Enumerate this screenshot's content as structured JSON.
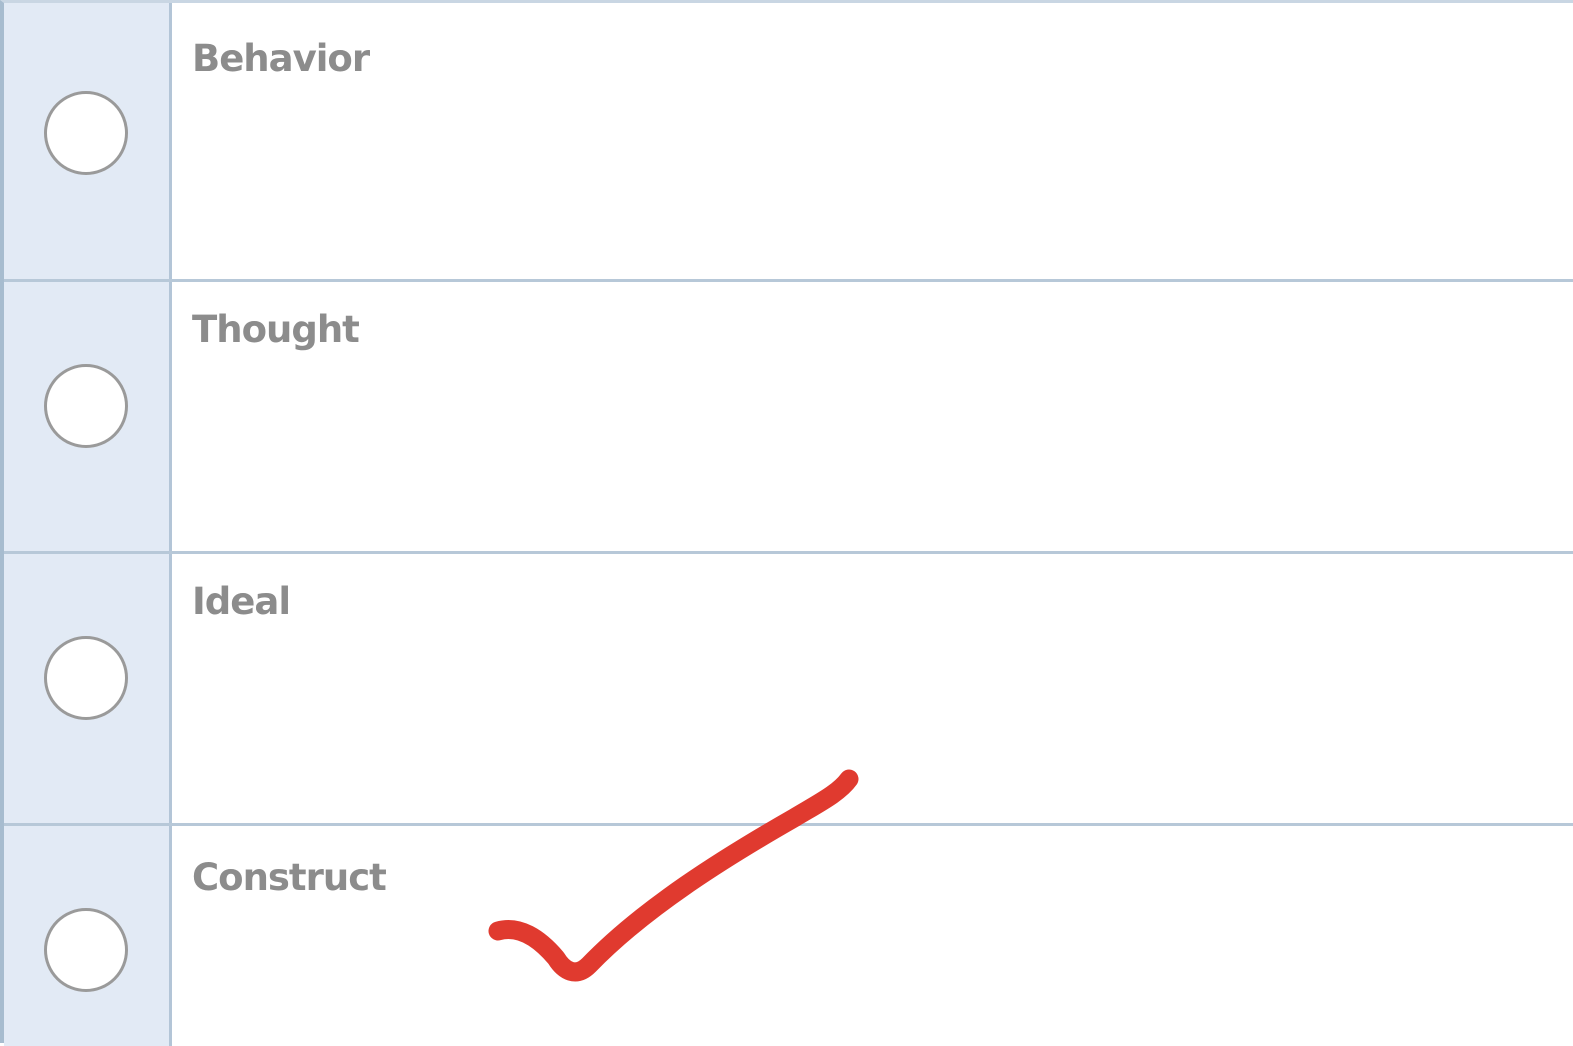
{
  "options": [
    {
      "label": "Behavior",
      "selected": false
    },
    {
      "label": "Thought",
      "selected": false
    },
    {
      "label": "Ideal",
      "selected": false
    },
    {
      "label": "Construct",
      "selected": false
    }
  ],
  "annotation": {
    "icon": "handwritten-checkmark-icon",
    "color": "#e03a2f",
    "marks_option": "Construct"
  },
  "colors": {
    "gutter": "#e2eaf5",
    "divider": "#b7c8d8",
    "label_text": "#8c8c8c",
    "radio_border": "#9a9a9a"
  }
}
